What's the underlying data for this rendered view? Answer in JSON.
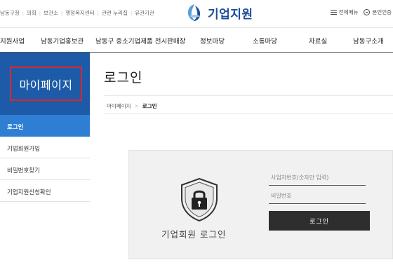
{
  "utility": {
    "links": [
      "남동구청",
      "의회",
      "보건소",
      "행정복지센터",
      "관련 누리집",
      "유관기관"
    ],
    "site_title": "기업지원",
    "all_menu_label": "전체메뉴",
    "auth_label": "본인인증"
  },
  "nav": {
    "items": [
      "지원사업",
      "남동기업홍보관",
      "남동구 중소기업제품 전시판매장",
      "정보마당",
      "소통마당",
      "자료실",
      "남동구소개"
    ]
  },
  "sidebar": {
    "title": "마이페이지",
    "items": [
      {
        "label": "로그인",
        "active": true
      },
      {
        "label": "기업회원가입",
        "active": false
      },
      {
        "label": "비밀번호찾기",
        "active": false
      },
      {
        "label": "기업지원신청확인",
        "active": false
      }
    ]
  },
  "content": {
    "page_title": "로그인",
    "breadcrumb": [
      "마이페이지",
      "로그인"
    ]
  },
  "login": {
    "heading": "기업회원 로그인",
    "id_placeholder": "사업자번호(숫자만 입력)",
    "pw_placeholder": "비밀번호",
    "button_label": "로그인"
  },
  "colors": {
    "brand_blue": "#1d5ba8",
    "active_blue": "#2e7fd4",
    "highlight_red": "#e0252a",
    "button_dark": "#2e2e2e"
  },
  "icons": [
    "logo-icon",
    "menu-icon",
    "auth-icon",
    "lock-shield-icon"
  ]
}
